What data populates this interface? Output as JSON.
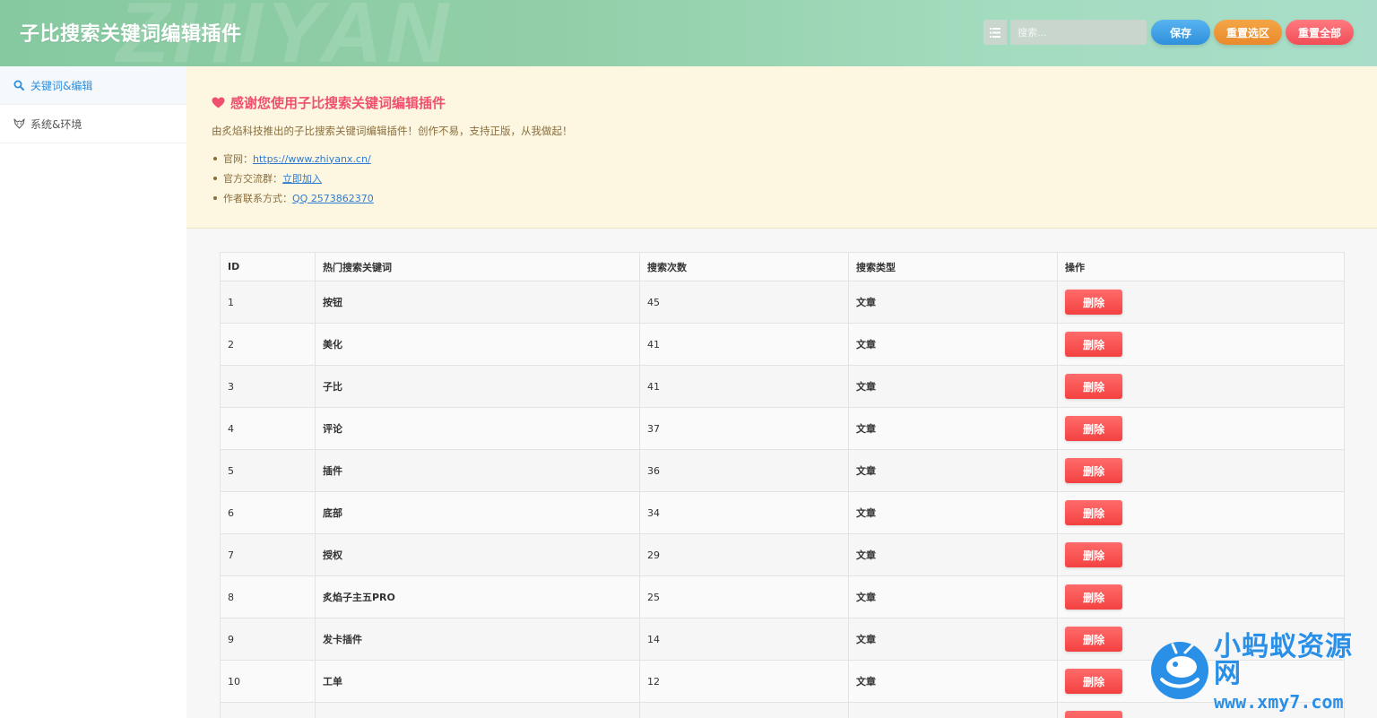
{
  "header": {
    "title": "子比搜索关键词编辑插件",
    "watermark": "ZHIYAN",
    "search_placeholder": "搜索...",
    "list_icon": "list-icon",
    "buttons": {
      "save": "保存",
      "reset_selection": "重置选区",
      "reset_all": "重置全部"
    },
    "colors": {
      "save": "#3a9be3",
      "reset_selection": "#ee932f",
      "reset_all": "#f45b63"
    }
  },
  "sidebar": {
    "items": [
      {
        "label": "关键词&编辑",
        "icon": "search-icon",
        "active": true
      },
      {
        "label": "系统&环境",
        "icon": "fox-icon",
        "active": false
      }
    ]
  },
  "notice": {
    "title": "感谢您使用子比搜索关键词编辑插件",
    "description": "由炙焰科技推出的子比搜索关键词编辑插件！创作不易，支持正版，从我做起！",
    "links": [
      {
        "label": "官网：",
        "link_text": "https://www.zhiyanx.cn/"
      },
      {
        "label": "官方交流群：",
        "link_text": "立即加入"
      },
      {
        "label": "作者联系方式：",
        "link_text": "QQ 2573862370"
      }
    ]
  },
  "table": {
    "columns": [
      "ID",
      "热门搜索关键词",
      "搜索次数",
      "搜索类型",
      "操作"
    ],
    "delete_label": "删除",
    "rows": [
      {
        "id": "1",
        "keyword": "按钮",
        "count": "45",
        "type": "文章"
      },
      {
        "id": "2",
        "keyword": "美化",
        "count": "41",
        "type": "文章"
      },
      {
        "id": "3",
        "keyword": "子比",
        "count": "41",
        "type": "文章"
      },
      {
        "id": "4",
        "keyword": "评论",
        "count": "37",
        "type": "文章"
      },
      {
        "id": "5",
        "keyword": "插件",
        "count": "36",
        "type": "文章"
      },
      {
        "id": "6",
        "keyword": "底部",
        "count": "34",
        "type": "文章"
      },
      {
        "id": "7",
        "keyword": "授权",
        "count": "29",
        "type": "文章"
      },
      {
        "id": "8",
        "keyword": "炙焰子主五PRO",
        "count": "25",
        "type": "文章"
      },
      {
        "id": "9",
        "keyword": "发卡插件",
        "count": "14",
        "type": "文章"
      },
      {
        "id": "10",
        "keyword": "工单",
        "count": "12",
        "type": "文章"
      },
      {
        "id": "",
        "keyword": "",
        "count": "",
        "type": ""
      }
    ]
  },
  "corner_logo": {
    "line1": "小蚂蚁资源网",
    "line2": "www.xmy7.com",
    "icon": "ant-logo-icon"
  }
}
